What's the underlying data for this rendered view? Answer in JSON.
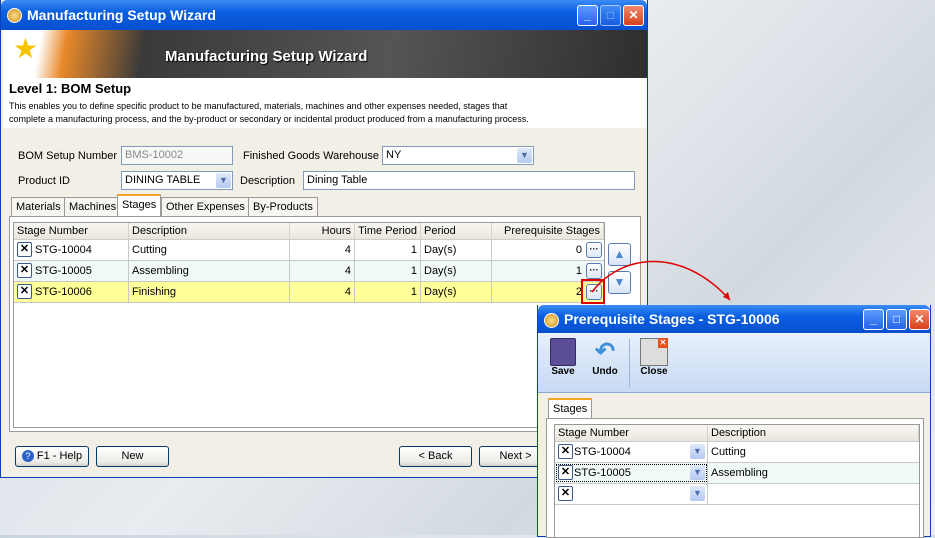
{
  "main_window": {
    "title": "Manufacturing Setup Wizard",
    "banner_title": "Manufacturing Setup Wizard",
    "level_title": "Level 1: BOM Setup",
    "description_line1": "This enables you to define specific product to be manufactured, materials, machines and other expenses needed, stages that",
    "description_line2": "complete a manufacturing process, and the by-product or secondary or incidental product produced from a manufacturing process.",
    "form": {
      "bom_label": "BOM Setup Number",
      "bom_value": "BMS-10002",
      "warehouse_label": "Finished Goods Warehouse",
      "warehouse_value": "NY",
      "product_label": "Product ID",
      "product_value": "DINING TABLE",
      "desc_label": "Description",
      "desc_value": "Dining Table"
    },
    "tabs": [
      "Materials",
      "Machines",
      "Stages",
      "Other Expenses",
      "By-Products"
    ],
    "active_tab": "Stages",
    "grid": {
      "columns": [
        "Stage Number",
        "Description",
        "Hours",
        "Time Period",
        "Period",
        "Prerequisite Stages"
      ],
      "rows": [
        {
          "stage": "STG-10004",
          "desc": "Cutting",
          "hours": "4",
          "time_period": "1",
          "period": "Day(s)",
          "prereq": "0"
        },
        {
          "stage": "STG-10005",
          "desc": "Assembling",
          "hours": "4",
          "time_period": "1",
          "period": "Day(s)",
          "prereq": "1"
        },
        {
          "stage": "STG-10006",
          "desc": "Finishing",
          "hours": "4",
          "time_period": "1",
          "period": "Day(s)",
          "prereq": "2"
        }
      ]
    },
    "buttons": {
      "help": "F1 - Help",
      "new": "New",
      "back": "< Back",
      "next": "Next >"
    }
  },
  "dialog": {
    "title": "Prerequisite Stages - STG-10006",
    "toolbar": {
      "save": "Save",
      "undo": "Undo",
      "close": "Close"
    },
    "tab": "Stages",
    "grid": {
      "columns": [
        "Stage Number",
        "Description"
      ],
      "rows": [
        {
          "stage": "STG-10004",
          "desc": "Cutting"
        },
        {
          "stage": "STG-10005",
          "desc": "Assembling"
        },
        {
          "stage": "",
          "desc": ""
        }
      ]
    }
  },
  "colors": {
    "titlebar": "#0a5fe0",
    "selected_row": "#ffff99",
    "annotation": "#e00000",
    "tab_accent": "#f5a623"
  },
  "icons": {
    "x_button": "✕",
    "ellipsis": "···",
    "up": "▲",
    "down": "▼"
  }
}
